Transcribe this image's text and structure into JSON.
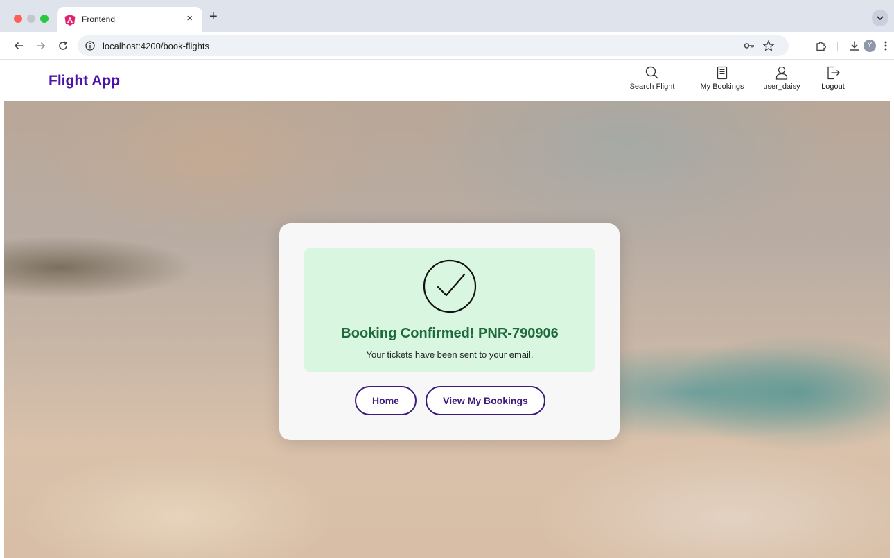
{
  "browser": {
    "tab_title": "Frontend",
    "tab_close": "×",
    "new_tab": "+",
    "url": "localhost:4200/book-flights",
    "profile_initial": "Y"
  },
  "app": {
    "brand": "Flight App",
    "brand_color": "#4a12a8",
    "nav": [
      {
        "label": "Search Flight",
        "icon": "search-icon"
      },
      {
        "label": "My Bookings",
        "icon": "document-icon"
      },
      {
        "label": "user_daisy",
        "icon": "user-icon"
      },
      {
        "label": "Logout",
        "icon": "logout-icon"
      }
    ]
  },
  "confirmation": {
    "title": "Booking Confirmed! PNR-790906",
    "subtitle": "Your tickets have been sent to your email.",
    "icon": "check-circle-icon",
    "success_color": "#1d6b39",
    "panel_color": "#d8f6e0"
  },
  "actions": {
    "home_label": "Home",
    "view_bookings_label": "View My Bookings",
    "button_color": "#3b1c7a"
  }
}
